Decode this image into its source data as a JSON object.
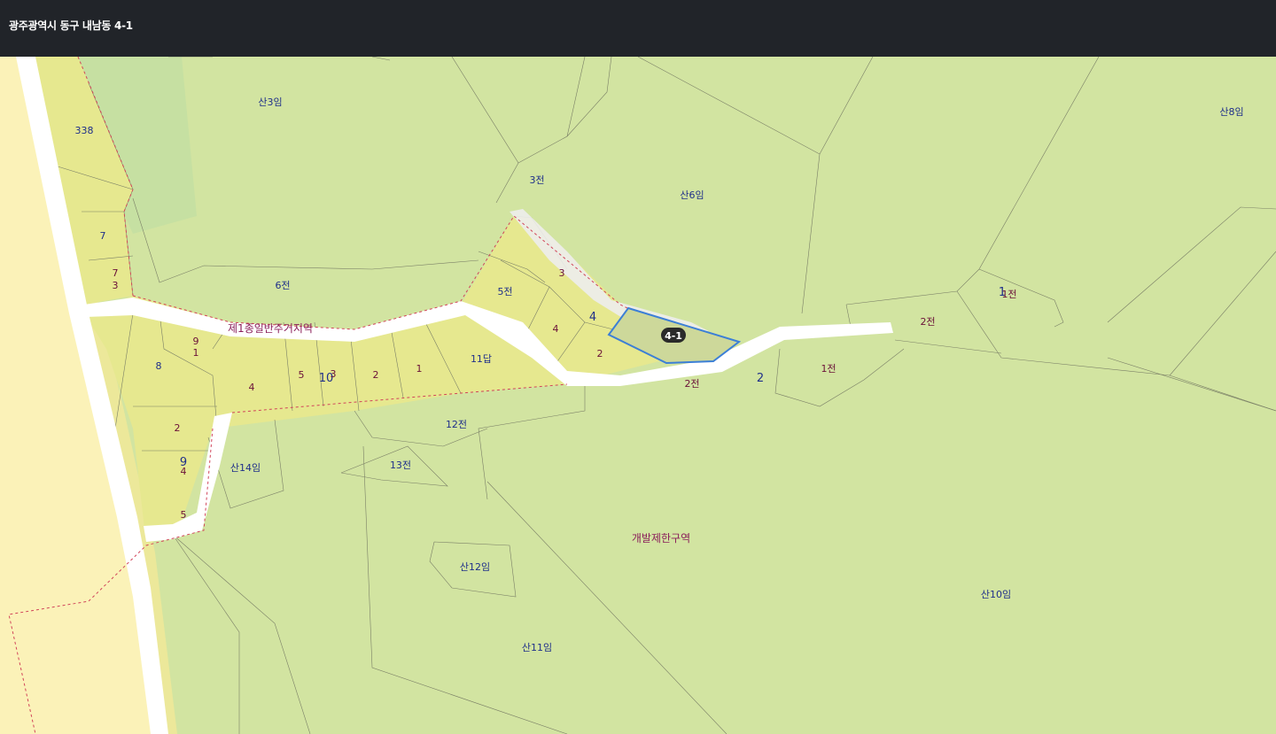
{
  "header": {
    "title": "광주광역시 동구 내남동 4-1"
  },
  "map": {
    "selected_parcel": "4-1",
    "zones": [
      "제1종일반주거지역",
      "개발제한구역"
    ],
    "labels": {
      "san3": "산3임",
      "san6": "산6임",
      "san8": "산8임",
      "jeon3": "3전",
      "n338": "338",
      "n7a": "7",
      "n7b": "7",
      "n3a": "3",
      "n6jeon": "6전",
      "n5jeon": "5전",
      "n3b": "3",
      "n4a": "4",
      "n4b": "4",
      "n2a": "2",
      "n9": "9",
      "n1a": "1",
      "n8": "8",
      "n4c": "4",
      "n5a": "5",
      "n10": "10",
      "n3c": "3",
      "n2b": "2",
      "n1b": "1",
      "n11dap": "11답",
      "n2jeon_road": "2전",
      "n2road": "2",
      "n1jeon_a": "1전",
      "n1jeon_b": "1전",
      "n1big": "1",
      "n2jeon": "2전",
      "n12jeon": "12전",
      "n13jeon": "13전",
      "san14": "산14임",
      "n2c": "2",
      "n9b": "9",
      "n4d": "4",
      "n5b": "5",
      "san12": "산12임",
      "san11": "산11임",
      "san10": "산10임"
    },
    "colors": {
      "forest": "#d2e4a1",
      "residential": "#e6e88f",
      "road": "#ffffff",
      "left_zone": "#fbf2b8",
      "selected_outline": "#3c7fd6",
      "zone_boundary": "#d1455a"
    }
  }
}
